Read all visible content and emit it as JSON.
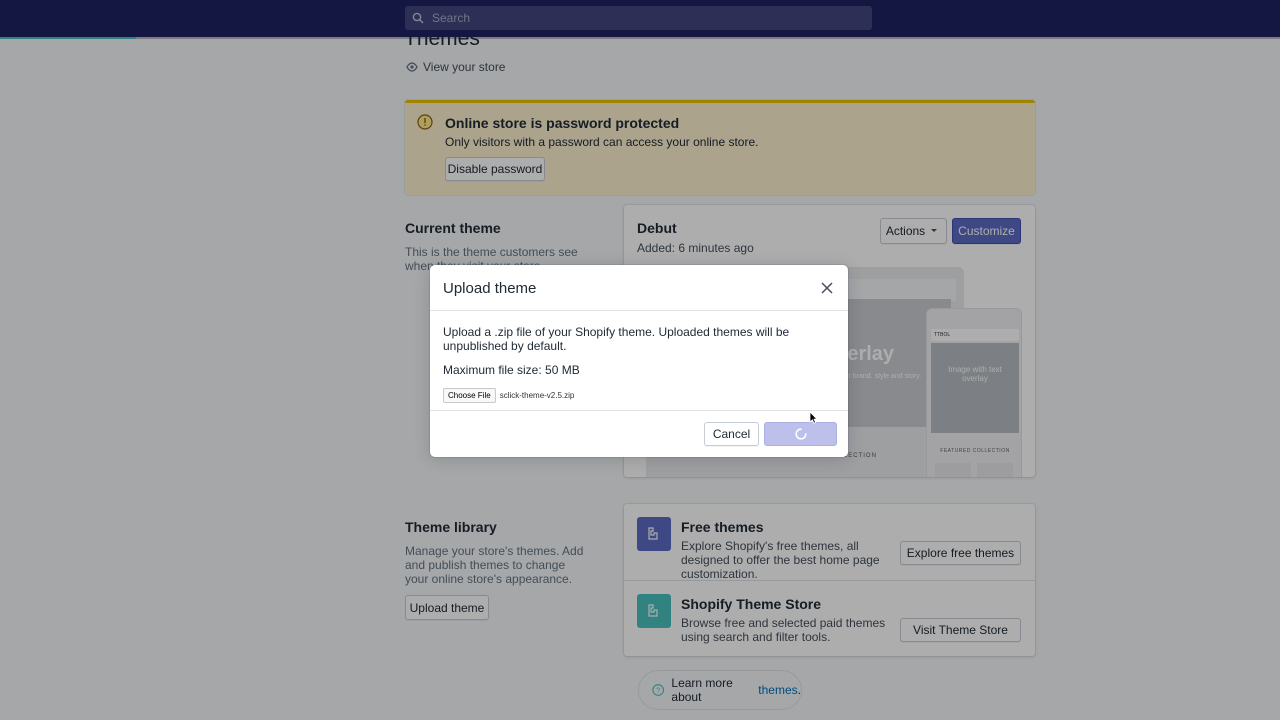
{
  "topbar": {
    "search_placeholder": "Search",
    "progress_fraction": 0.106
  },
  "page": {
    "title": "Themes",
    "view_store": "View your store"
  },
  "banner": {
    "title": "Online store is password protected",
    "description": "Only visitors with a password can access your online store.",
    "button": "Disable password"
  },
  "current_theme": {
    "heading": "Current theme",
    "description": "This is the theme customers see when they visit your store.",
    "name": "Debut",
    "added": "Added: 6 minutes ago",
    "actions_label": "Actions",
    "customize_label": "Customize",
    "preview": {
      "hero_text": "overlay",
      "hero_sub": "into your brand. style and story.",
      "featured": "FEATURED COLLECTION",
      "phone_hero": "Image with text overlay",
      "phone_featured": "FEATURED COLLECTION",
      "phone_brand": "TTBOL"
    }
  },
  "library": {
    "heading": "Theme library",
    "description": "Manage your store's themes. Add and publish themes to change your online store's appearance.",
    "upload_label": "Upload theme",
    "items": [
      {
        "title": "Free themes",
        "description": "Explore Shopify's free themes, all designed to offer the best home page customization.",
        "button": "Explore free themes",
        "icon_color": "#5c6ac4"
      },
      {
        "title": "Shopify Theme Store",
        "description": "Browse free and selected paid themes using search and filter tools.",
        "button": "Visit Theme Store",
        "icon_color": "#47c1bf"
      }
    ]
  },
  "learn_more": {
    "text": "Learn more about",
    "link": "themes",
    "suffix": "."
  },
  "modal": {
    "title": "Upload theme",
    "description": "Upload a .zip file of your Shopify theme. Uploaded themes will be unpublished by default.",
    "max_size": "Maximum file size: 50 MB",
    "choose_file": "Choose File",
    "file_name": "sclick-theme-v2.5.zip",
    "cancel": "Cancel"
  },
  "colors": {
    "topbar": "#1c2260",
    "primary": "#5c6ac4",
    "banner": "#fcf1cd",
    "teal": "#47c1bf"
  }
}
